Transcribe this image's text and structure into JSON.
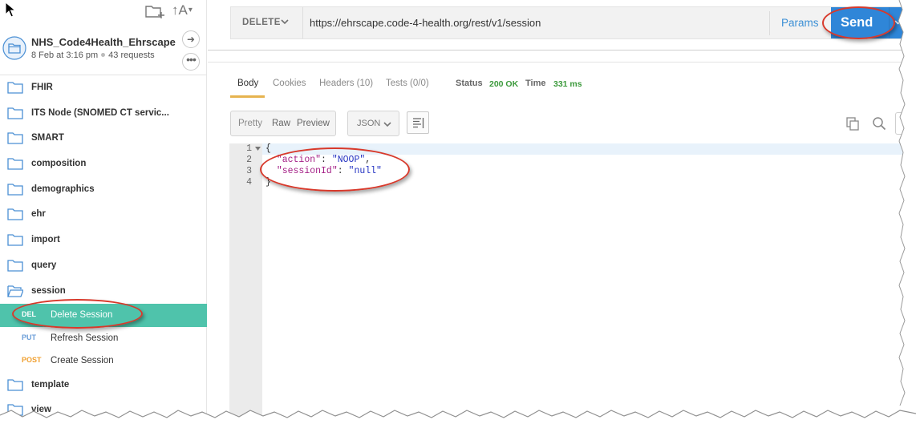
{
  "sidebar": {
    "collection": {
      "name": "NHS_Code4Health_Ehrscape",
      "date": "8 Feb at 3:16 pm",
      "requests": "43 requests"
    },
    "folders_top": [
      {
        "label": "FHIR"
      },
      {
        "label": "ITS Node (SNOMED CT servic..."
      },
      {
        "label": "SMART"
      },
      {
        "label": "composition"
      },
      {
        "label": "demographics"
      },
      {
        "label": "ehr"
      },
      {
        "label": "import"
      },
      {
        "label": "query"
      },
      {
        "label": "session"
      }
    ],
    "requests": [
      {
        "method": "DEL",
        "method_color": "#4fc3ab",
        "label": "Delete Session",
        "active": true
      },
      {
        "method": "PUT",
        "method_color": "#6b9ed8",
        "label": "Refresh Session",
        "active": false
      },
      {
        "method": "POST",
        "method_color": "#f0a030",
        "label": "Create Session",
        "active": false
      }
    ],
    "folders_bottom": [
      {
        "label": "template"
      },
      {
        "label": "view"
      }
    ]
  },
  "request": {
    "method": "DELETE",
    "url": "https://ehrscape.code-4-health.org/rest/v1/session",
    "params_label": "Params",
    "send_label": "Send"
  },
  "response": {
    "tabs": [
      "Body",
      "Cookies",
      "Headers (10)",
      "Tests (0/0)"
    ],
    "active_tab": "Body",
    "status_label": "Status",
    "status_value": "200 OK",
    "time_label": "Time",
    "time_value": "331 ms",
    "views": [
      "Pretty",
      "Raw",
      "Preview"
    ],
    "format": "JSON",
    "line_numbers": [
      "1",
      "2",
      "3",
      "4"
    ],
    "body": {
      "open_brace": "{",
      "key1": "\"action\"",
      "val1": "\"NOOP\"",
      "key2": "\"sessionId\"",
      "val2": "\"null\"",
      "close_brace": "}"
    }
  },
  "colors": {
    "accent_send": "#2f86d8",
    "active_request": "#4fc3ab",
    "status_ok": "#3c9a3c",
    "annotation": "#d8392b"
  },
  "icons": [
    "cursor-icon",
    "new-folder-icon",
    "sort-icon",
    "folder-icon",
    "open-folder-icon",
    "arrow-right-icon",
    "ellipsis-icon",
    "chevron-down-icon",
    "wrap-lines-icon",
    "copy-icon",
    "search-icon"
  ]
}
